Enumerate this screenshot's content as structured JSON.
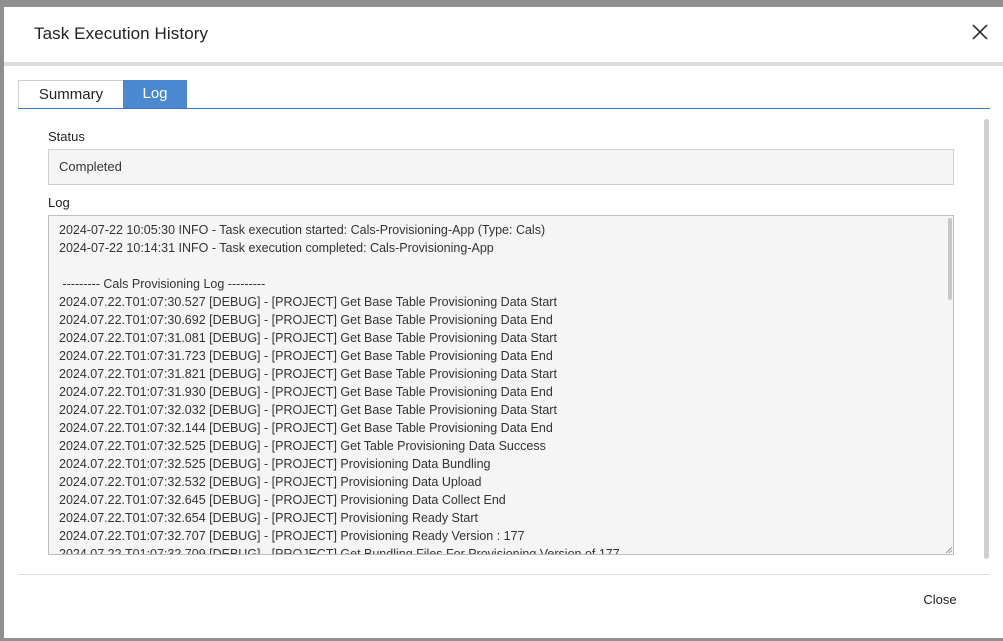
{
  "dialog": {
    "title": "Task Execution History",
    "close_icon": "close-icon"
  },
  "tabs": [
    {
      "label": "Summary",
      "active": false
    },
    {
      "label": "Log",
      "active": true
    }
  ],
  "fields": {
    "status_label": "Status",
    "status_value": "Completed",
    "log_label": "Log"
  },
  "log_lines": [
    "2024-07-22 10:05:30 INFO - Task execution started: Cals-Provisioning-App (Type: Cals)",
    "2024-07-22 10:14:31 INFO - Task execution completed: Cals-Provisioning-App",
    "",
    " --------- Cals Provisioning Log ---------",
    "2024.07.22.T01:07:30.527 [DEBUG] - [PROJECT] Get Base Table Provisioning Data Start",
    "2024.07.22.T01:07:30.692 [DEBUG] - [PROJECT] Get Base Table Provisioning Data End",
    "2024.07.22.T01:07:31.081 [DEBUG] - [PROJECT] Get Base Table Provisioning Data Start",
    "2024.07.22.T01:07:31.723 [DEBUG] - [PROJECT] Get Base Table Provisioning Data End",
    "2024.07.22.T01:07:31.821 [DEBUG] - [PROJECT] Get Base Table Provisioning Data Start",
    "2024.07.22.T01:07:31.930 [DEBUG] - [PROJECT] Get Base Table Provisioning Data End",
    "2024.07.22.T01:07:32.032 [DEBUG] - [PROJECT] Get Base Table Provisioning Data Start",
    "2024.07.22.T01:07:32.144 [DEBUG] - [PROJECT] Get Base Table Provisioning Data End",
    "2024.07.22.T01:07:32.525 [DEBUG] - [PROJECT] Get Table Provisioning Data Success",
    "2024.07.22.T01:07:32.525 [DEBUG] - [PROJECT] Provisioning Data Bundling",
    "2024.07.22.T01:07:32.532 [DEBUG] - [PROJECT] Provisioning Data Upload",
    "2024.07.22.T01:07:32.645 [DEBUG] - [PROJECT] Provisioning Data Collect End",
    "2024.07.22.T01:07:32.654 [DEBUG] - [PROJECT] Provisioning Ready Start",
    "2024.07.22.T01:07:32.707 [DEBUG] - [PROJECT] Provisioning Ready Version : 177",
    "2024.07.22.T01:07:32.709 [DEBUG] - [PROJECT] Get Bundling Files For Provisioning Version of 177"
  ],
  "footer": {
    "close_label": "Close"
  },
  "colors": {
    "accent": "#4a89d0",
    "overlay": "#8f8f8f"
  }
}
